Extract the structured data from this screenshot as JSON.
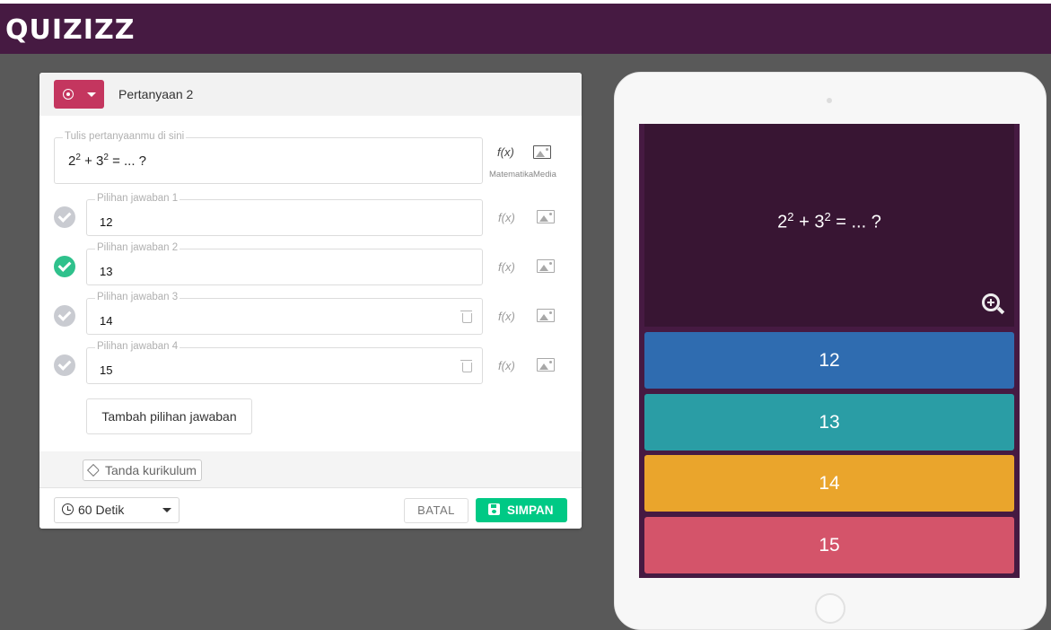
{
  "app": {
    "logo": "QUIZIZZ"
  },
  "editor": {
    "question_title": "Pertanyaan 2",
    "question_field": {
      "legend": "Tulis pertanyaanmu di sini",
      "base1": "2",
      "exp1": "2",
      "op": " + ",
      "base2": "3",
      "exp2": "2",
      "rest": " = ... ?"
    },
    "tools": {
      "math_icon": "f(x)",
      "math_label": "Matematika",
      "media_label": "Media"
    },
    "answers": [
      {
        "legend": "Pilihan jawaban 1",
        "value": "12",
        "correct": false
      },
      {
        "legend": "Pilihan jawaban 2",
        "value": "13",
        "correct": true
      },
      {
        "legend": "Pilihan jawaban 3",
        "value": "14",
        "correct": false
      },
      {
        "legend": "Pilihan jawaban 4",
        "value": "15",
        "correct": false
      }
    ],
    "add_answer_label": "Tambah pilihan jawaban",
    "curriculum_tag_label": "Tanda kurikulum",
    "timer_value": "60 Detik",
    "cancel_label": "BATAL",
    "save_label": "SIMPAN"
  },
  "preview": {
    "question": {
      "base1": "2",
      "exp1": "2",
      "op": " + ",
      "base2": "3",
      "exp2": "2",
      "rest": " = ... ?"
    },
    "options": [
      "12",
      "13",
      "14",
      "15"
    ]
  },
  "colors": {
    "topbar": "#461a42",
    "type_button": "#c4365f",
    "save": "#00c985",
    "option_blue": "#2f6cb0",
    "option_teal": "#2a9da5",
    "option_yellow": "#eaa52c",
    "option_red": "#d4546a"
  },
  "icons": [
    "quiz-type-icon",
    "clock-icon",
    "save-icon",
    "tag-icon",
    "math-icon",
    "media-icon",
    "image-icon",
    "trash-icon",
    "check-icon",
    "zoom-in-icon"
  ]
}
